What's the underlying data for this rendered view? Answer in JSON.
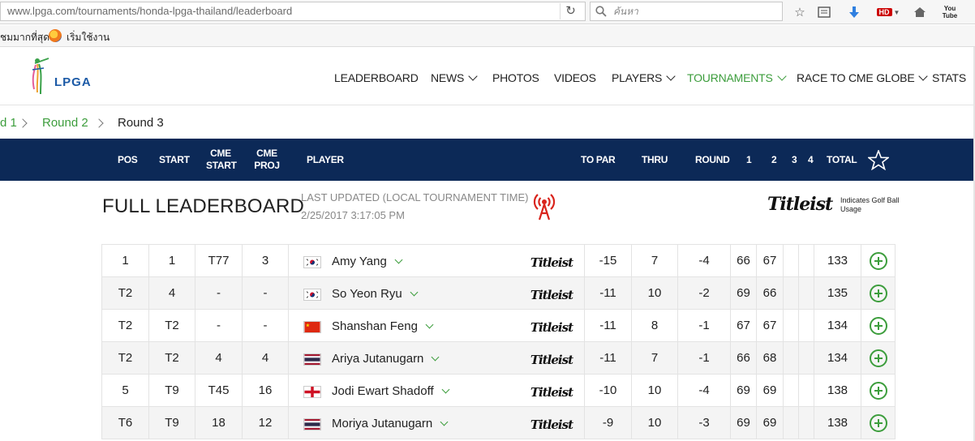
{
  "browser": {
    "url": "www.lpga.com/tournaments/honda-lpga-thailand/leaderboard",
    "search_placeholder": "ค้นหา",
    "hd_badge": "HD",
    "youtube_label": "You Tube",
    "bookmarks": [
      "ชมมากที่สุด",
      "เริ่มใช้งาน"
    ]
  },
  "site": {
    "logo_text": "LPGA",
    "nav": [
      {
        "label": "LEADERBOARD",
        "dropdown": false,
        "active": false
      },
      {
        "label": "NEWS",
        "dropdown": true,
        "active": false
      },
      {
        "label": "PHOTOS",
        "dropdown": false,
        "active": false
      },
      {
        "label": "VIDEOS",
        "dropdown": false,
        "active": false
      },
      {
        "label": "PLAYERS",
        "dropdown": true,
        "active": false
      },
      {
        "label": "TOURNAMENTS",
        "dropdown": true,
        "active": true
      },
      {
        "label": "RACE TO CME GLOBE",
        "dropdown": true,
        "active": false
      },
      {
        "label": "STATS",
        "dropdown": false,
        "active": false
      }
    ]
  },
  "breadcrumb": [
    "d 1",
    "Round 2",
    "Round 3"
  ],
  "columns": {
    "pos": "POS",
    "start": "START",
    "cme_start": [
      "CME",
      "START"
    ],
    "cme_proj": [
      "CME",
      "PROJ"
    ],
    "player": "PLAYER",
    "to_par": "TO PAR",
    "thru": "THRU",
    "round": "ROUND",
    "r1": "1",
    "r2": "2",
    "r3": "3",
    "r4": "4",
    "total": "TOTAL"
  },
  "leaderboard": {
    "title": "FULL LEADERBOARD",
    "updated_label": "LAST UPDATED (LOCAL TOURNAMENT TIME)",
    "updated_time": "2/25/2017 3:17:05 PM",
    "sponsor": "Titleist",
    "sponsor_note": "Indicates Golf Ball Usage"
  },
  "rows": [
    {
      "pos": "1",
      "start": "1",
      "cme_start": "T77",
      "cme_proj": "3",
      "flag": "KOR",
      "player": "Amy Yang",
      "ball": "Titleist",
      "to_par": "-15",
      "thru": "7",
      "round": "-4",
      "r1": "66",
      "r2": "67",
      "r3": "",
      "r4": "",
      "total": "133"
    },
    {
      "pos": "T2",
      "start": "4",
      "cme_start": "-",
      "cme_proj": "-",
      "flag": "KOR",
      "player": "So Yeon Ryu",
      "ball": "Titleist",
      "to_par": "-11",
      "thru": "10",
      "round": "-2",
      "r1": "69",
      "r2": "66",
      "r3": "",
      "r4": "",
      "total": "135"
    },
    {
      "pos": "T2",
      "start": "T2",
      "cme_start": "-",
      "cme_proj": "-",
      "flag": "CHN",
      "player": "Shanshan Feng",
      "ball": "Titleist",
      "to_par": "-11",
      "thru": "8",
      "round": "-1",
      "r1": "67",
      "r2": "67",
      "r3": "",
      "r4": "",
      "total": "134"
    },
    {
      "pos": "T2",
      "start": "T2",
      "cme_start": "4",
      "cme_proj": "4",
      "flag": "THA",
      "player": "Ariya Jutanugarn",
      "ball": "Titleist",
      "to_par": "-11",
      "thru": "7",
      "round": "-1",
      "r1": "66",
      "r2": "68",
      "r3": "",
      "r4": "",
      "total": "134"
    },
    {
      "pos": "5",
      "start": "T9",
      "cme_start": "T45",
      "cme_proj": "16",
      "flag": "ENG",
      "player": "Jodi Ewart Shadoff",
      "ball": "Titleist",
      "to_par": "-10",
      "thru": "10",
      "round": "-4",
      "r1": "69",
      "r2": "69",
      "r3": "",
      "r4": "",
      "total": "138"
    },
    {
      "pos": "T6",
      "start": "T9",
      "cme_start": "18",
      "cme_proj": "12",
      "flag": "THA",
      "player": "Moriya Jutanugarn",
      "ball": "Titleist",
      "to_par": "-9",
      "thru": "10",
      "round": "-3",
      "r1": "69",
      "r2": "69",
      "r3": "",
      "r4": "",
      "total": "138"
    }
  ],
  "colors": {
    "accent_green": "#3c9d3c",
    "header_navy": "#0c2957",
    "logo_blue": "#1c5aa6"
  },
  "icons": {
    "browser": [
      "reload-icon",
      "search-icon",
      "star-icon",
      "reader-icon",
      "download-icon",
      "home-icon",
      "firefox-icon"
    ],
    "page": [
      "favorite-star-icon",
      "live-broadcast-icon",
      "expand-plus-icon",
      "chevron-down-icon"
    ]
  }
}
